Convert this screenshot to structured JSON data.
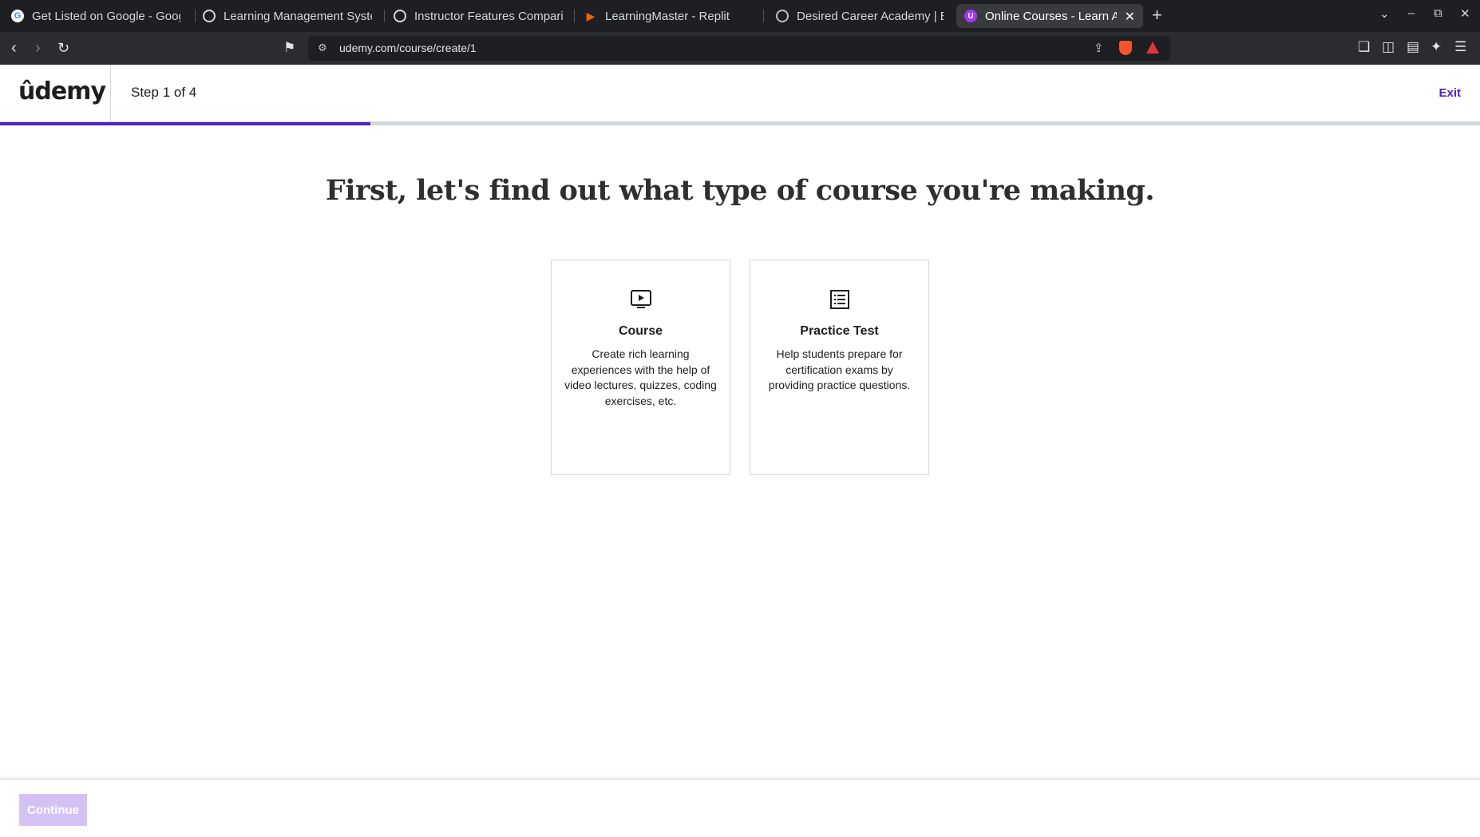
{
  "browser": {
    "tabs": [
      {
        "title": "Get Listed on Google - Goog",
        "icon": "google-icon"
      },
      {
        "title": "Learning Management Syste",
        "icon": "openai-icon"
      },
      {
        "title": "Instructor Features Compari",
        "icon": "openai-icon"
      },
      {
        "title": "LearningMaster - Replit",
        "icon": "replit-icon"
      },
      {
        "title": "Desired Career Academy | Er",
        "icon": "globe-icon"
      },
      {
        "title": "Online Courses - Learn A",
        "icon": "udemy-icon",
        "active": true
      }
    ],
    "url": "udemy.com/course/create/1"
  },
  "header": {
    "logo": "ûdemy",
    "step": "Step 1 of 4",
    "exit": "Exit",
    "progress": 0.25
  },
  "main": {
    "headline": "First, let's find out what type of course you're making.",
    "cards": [
      {
        "title": "Course",
        "description": "Create rich learning experiences with the help of video lectures, quizzes, coding exercises, etc.",
        "icon": "video-icon"
      },
      {
        "title": "Practice Test",
        "description": "Help students prepare for certification exams by providing practice questions.",
        "icon": "list-icon"
      }
    ]
  },
  "footer": {
    "continue": "Continue"
  },
  "colors": {
    "brand_purple": "#5022c3",
    "logo_purple": "#a435f0",
    "disabled_button": "#d5c2f5"
  }
}
